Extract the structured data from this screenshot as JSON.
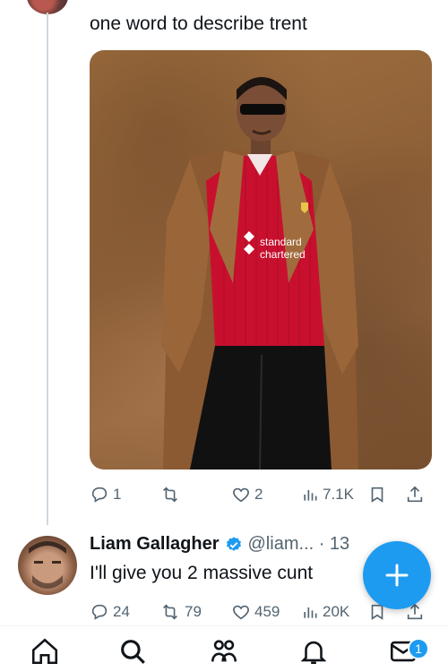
{
  "tweet": {
    "text": "one word to describe trent",
    "media_alt": "Photo of a man in sunglasses, red striped Liverpool football shirt and brown overcoat against a brown backdrop",
    "shirt_sponsor_line1": "standard",
    "shirt_sponsor_line2": "chartered",
    "actions": {
      "replies": "1",
      "reposts": "",
      "likes": "2",
      "views": "7.1K"
    }
  },
  "reply": {
    "name": "Liam Gallagher",
    "verified": true,
    "handle_time": "@liam... · 13",
    "text": "I'll give you 2 massive cunt",
    "actions": {
      "replies": "24",
      "reposts": "79",
      "likes": "459",
      "views": "20K"
    }
  },
  "fab": {
    "label": "+"
  },
  "nav": {
    "items": [
      "home-icon",
      "search-icon",
      "communities-icon",
      "notifications-icon",
      "messages-icon"
    ],
    "messages_badge": "1"
  },
  "colors": {
    "accent": "#1d9bf0",
    "secondary_text": "#536471",
    "shirt_red": "#c8102e"
  }
}
